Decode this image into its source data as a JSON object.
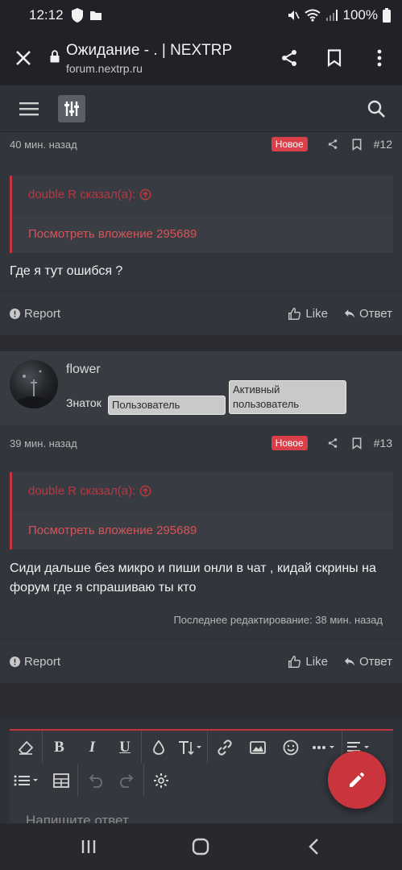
{
  "status_bar": {
    "time": "12:12",
    "battery": "100%"
  },
  "browser": {
    "title": "Ожидание - . | NEXTRP",
    "url": "forum.nextrp.ru"
  },
  "posts": [
    {
      "time": "40 мин. назад",
      "badge": "Новое",
      "number": "#12",
      "quote_author": "double R сказал(а):",
      "quote_link": "Посмотреть вложение 295689",
      "text": "Где я тут ошибся ?",
      "report_label": "Report",
      "like_label": "Like",
      "reply_label": "Ответ"
    },
    {
      "author": "flower",
      "user_title": "Знаток",
      "user_badges": [
        "Пользователь",
        "Активный пользователь"
      ],
      "time": "39 мин. назад",
      "badge": "Новое",
      "number": "#13",
      "quote_author": "double R сказал(а):",
      "quote_link": "Посмотреть вложение 295689",
      "text": "Сиди дальше без микро и пиши онли в чат , кидай скрины на форум где я спрашиваю ты кто",
      "edited": "Последнее редактирование: 38 мин. назад",
      "report_label": "Report",
      "like_label": "Like",
      "reply_label": "Ответ"
    }
  ],
  "editor": {
    "placeholder": "Напишите ответ..."
  },
  "colors": {
    "accent": "#c9343d",
    "badge_new": "#d9404a",
    "background": "#2a2c31",
    "card": "#32353c"
  }
}
